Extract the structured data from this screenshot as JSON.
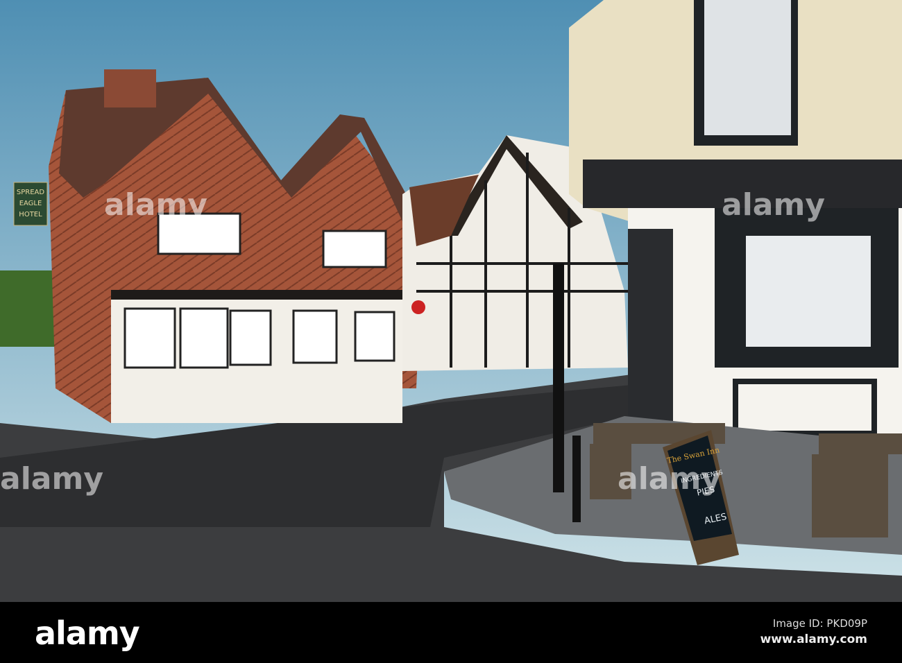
{
  "photo": {
    "hotel_sign": [
      "SPREAD",
      "EAGLE",
      "HOTEL"
    ],
    "aboard": {
      "title": "The Swan Inn",
      "line1": "INGREDIENTS",
      "line2": "PIES",
      "line3": "ALES"
    },
    "watermark": "alamy"
  },
  "footer": {
    "logo": "alamy",
    "image_id": "Image ID: PKD09P",
    "url": "www.alamy.com"
  }
}
